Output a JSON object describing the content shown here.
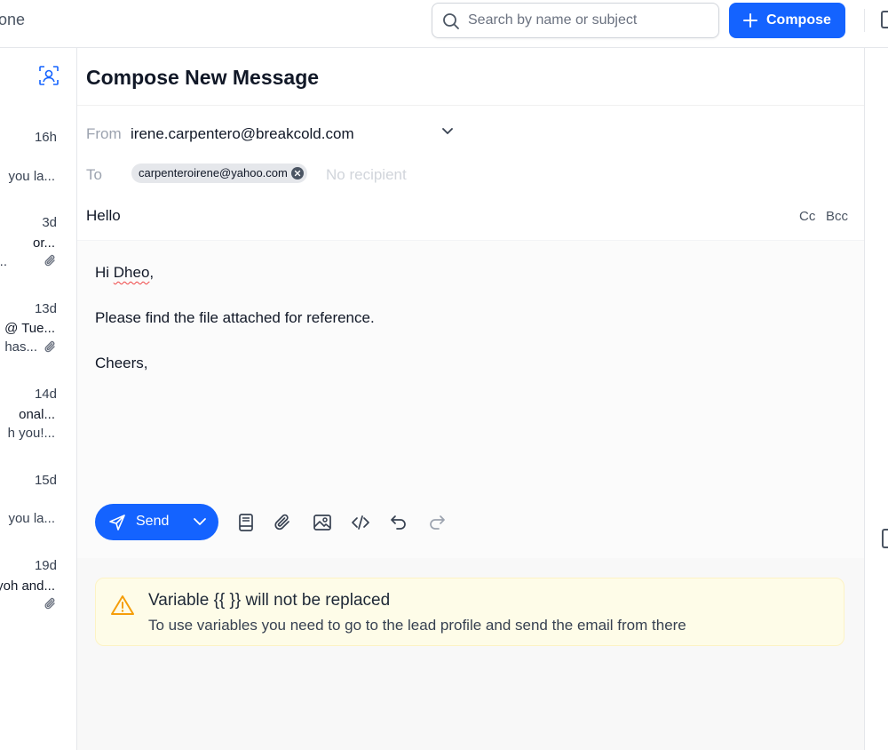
{
  "header": {
    "breadcrumb": "one",
    "search_placeholder": "Search by name or subject",
    "compose_label": "Compose"
  },
  "sidebar": {
    "items": [
      {
        "time": "16h",
        "line1": "",
        "line2": "you la...",
        "has_attachment": false
      },
      {
        "time": "3d",
        "line1": "or...",
        "line2": "...",
        "has_attachment": true
      },
      {
        "time": "13d",
        "line1": "@ Tue...",
        "line2": "has...",
        "has_attachment": true
      },
      {
        "time": "14d",
        "line1": "onal...",
        "line2": "h you!...",
        "has_attachment": false
      },
      {
        "time": "15d",
        "line1": "",
        "line2": "you la...",
        "has_attachment": false
      },
      {
        "time": "19d",
        "line1": "yoh and...",
        "line2": "",
        "has_attachment": true
      }
    ]
  },
  "compose": {
    "title": "Compose New Message",
    "from_label": "From",
    "from_value": "irene.carpentero@breakcold.com",
    "to_label": "To",
    "recipient_chip": "carpenteroirene@yahoo.com",
    "recipient_placeholder": "No recipient",
    "subject": "Hello",
    "cc_label": "Cc",
    "bcc_label": "Bcc",
    "body": {
      "greeting_prefix": "Hi ",
      "greeting_name": "Dheo",
      "greeting_suffix": ",",
      "line2": "Please find the file attached for reference.",
      "line3": "Cheers,"
    },
    "send_label": "Send"
  },
  "toolbar_icons": [
    "template-icon",
    "attachment-icon",
    "image-icon",
    "code-icon",
    "undo-icon",
    "redo-icon"
  ],
  "warning": {
    "title": "Variable {{ }} will not be replaced",
    "message": "To use variables you need to go to the lead profile and send the email from there"
  },
  "colors": {
    "primary": "#1463ff",
    "warning_bg": "#fefce8",
    "warning_icon": "#f59e0b"
  }
}
